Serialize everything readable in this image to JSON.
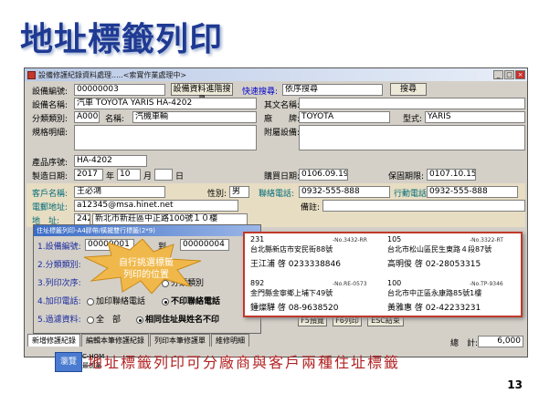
{
  "slide": {
    "title": "地址標籤列印",
    "caption": "地址標籤列印可分廠商與客戶兩種住址標籤",
    "page_number": "13"
  },
  "window": {
    "title": "設備修護紀錄資料處理.....<索實作業處理中>",
    "controls": [
      "_",
      "□",
      "×"
    ]
  },
  "form": {
    "equip_no_label": "設備編號:",
    "equip_no_value": "00000003",
    "progress_button": "設備資料進階搜尋",
    "quick_search_label": "快速搜尋:",
    "quick_search_value": "依序搜尋",
    "search_button": "搜尋",
    "equip_name_label": "設備名稱:",
    "equip_name_value": "汽車 TOYOTA YARIS HA-4202",
    "other_name_label": "其文名稱:",
    "category_label": "分類類別:",
    "category_code": "A0000",
    "name_label": "名稱:",
    "name_value": "汽機車輛",
    "maker_label": "廠　　牌:",
    "maker_value": "TOYOTA",
    "model_label": "型式:",
    "model_value": "YARIS",
    "spec_label": "規格明細:",
    "accessory_label": "附屬設備:",
    "serial_label": "產品序號:",
    "serial_value": "HA-4202",
    "mfg_date_label": "製造日期:",
    "mfg_year": "2017",
    "year_label": "年",
    "mfg_month": "10",
    "month_label": "月",
    "day_label": "日",
    "buy_date_label": "購買日期:",
    "buy_date_value": "0106.09.19",
    "warranty_label": "保固期限:",
    "warranty_value": "0107.10.15",
    "customer_label": "客戶名稱:",
    "customer_value": "王必鴻",
    "gender_label": "性別:",
    "gender_value": "男",
    "phone_label": "聯絡電話:",
    "phone_value": "0932-555-888",
    "mobile_label": "行動電話:",
    "mobile_value": "0932-555-888",
    "email_label": "電郵地址:",
    "email_value": "a12345@msa.hinet.net",
    "note_label": "備註:",
    "address_label": "地　址:",
    "zip_value": "242",
    "address_value": "新北市新莊區中正路100號１０樓",
    "total_label": "總　計:",
    "total_value": "6,000"
  },
  "dialog": {
    "title": "住址標籤列印-A4膠帶/橫擺雙行標籤(2*9)",
    "row1_label": "1.設備編號:",
    "row1_from": "00000001",
    "row1_to_label": "到",
    "row1_to": "00000004",
    "row2_label": "2.分類類別:",
    "row3_label": "3.列印次序:",
    "row3_option": "分類類別",
    "row4_label": "4.加印電話:",
    "row4_opt1": "加印聯絡電話",
    "row4_opt2": "不印聯絡電話",
    "row5_label": "5.過濾資料:",
    "row5_opt1": "全　部",
    "row5_opt2": "相同住址與姓名不印",
    "preview_button": "F5預覽",
    "print_button": "F6列印",
    "exit_button": "ESC結束"
  },
  "callout": {
    "text_line1": "自行挑選標籤",
    "text_line2": "列印的位置"
  },
  "label_sheet": {
    "labels": [
      {
        "zip": "231",
        "code": "-No.3432-RR",
        "addr": "台北縣新店市安民街88號",
        "name": "王江浦 啓 0233338846"
      },
      {
        "zip": "105",
        "code": "-No.3322-RT",
        "addr": "台北市松山區民生東路４段87號",
        "name": "高明俊 啓 02-28053315"
      },
      {
        "zip": "892",
        "code": "-No.RE-0573",
        "addr": "金門縣金寧鄉上埔下49號",
        "name": "鍾燦驊 啓 08-9638520"
      },
      {
        "zip": "100",
        "code": "-No.TP-9346",
        "addr": "台北市中正區永康路85號1樓",
        "name": "黃雅惠 啓 02-42233231"
      }
    ]
  },
  "tabs": [
    "新增修護紀錄",
    "編輯本筆修護紀錄",
    "列印本筆修護單",
    "維修明細"
  ],
  "bottom": {
    "browse_button": "瀏覽",
    "note_line1": "C-HOM",
    "note_line2": "最前筆"
  }
}
